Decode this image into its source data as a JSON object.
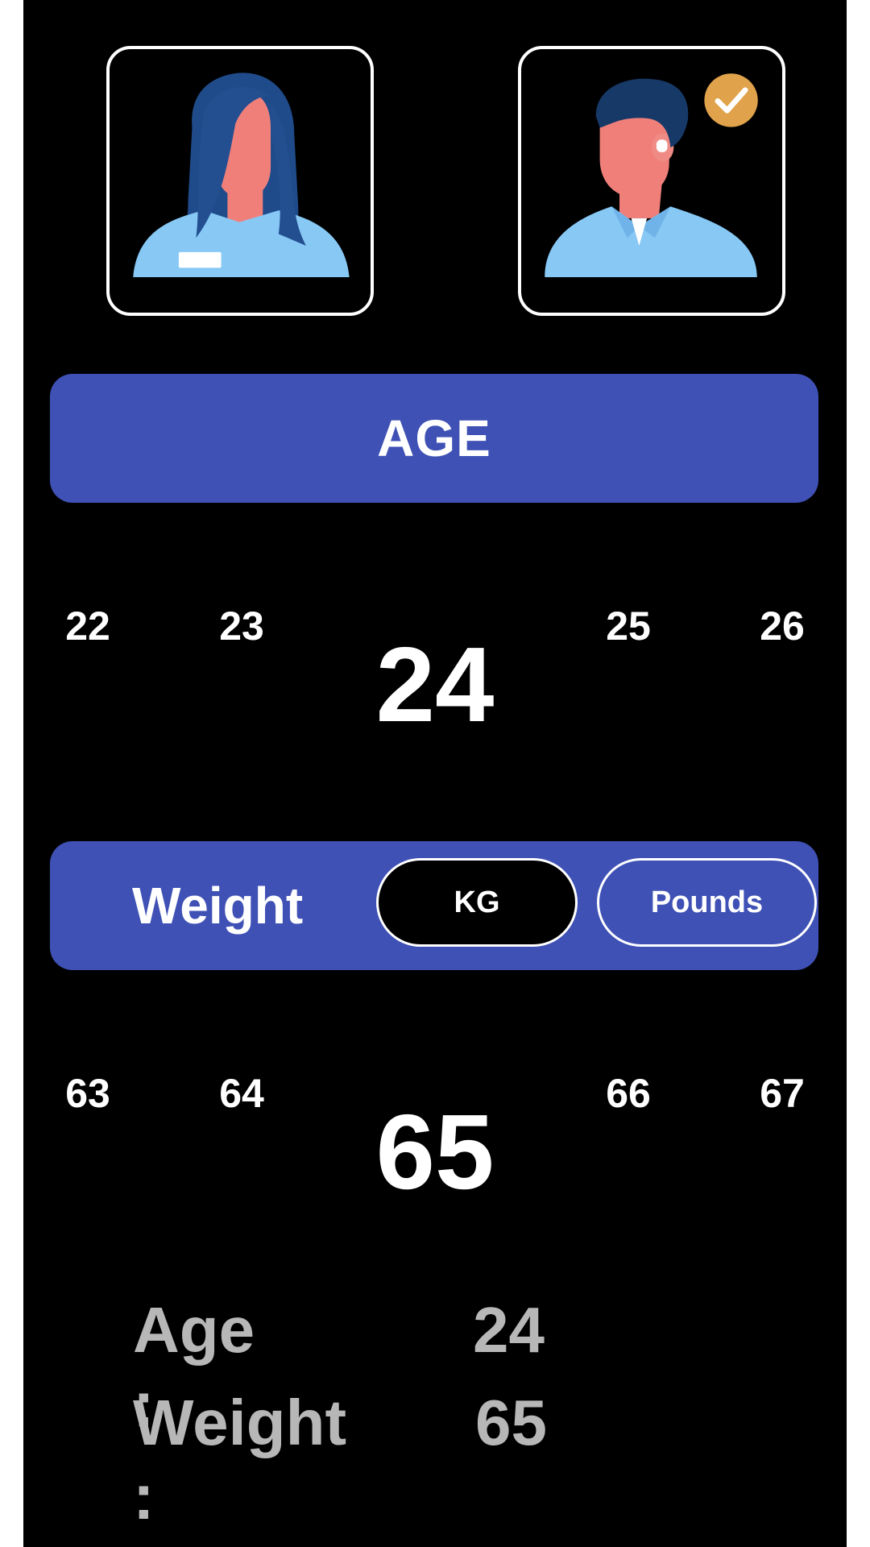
{
  "gender": {
    "female_label": "",
    "male_selected": true
  },
  "age": {
    "title": "AGE",
    "options": [
      "22",
      "23",
      "24",
      "25",
      "26"
    ],
    "selected": "24"
  },
  "weight": {
    "title": "Weight",
    "unit_kg": "KG",
    "unit_pounds": "Pounds",
    "active_unit": "KG",
    "options": [
      "63",
      "64",
      "65",
      "66",
      "67"
    ],
    "selected": "65"
  },
  "summary": {
    "age_label": "Age :",
    "age_value": "24",
    "weight_label": "Weight :",
    "weight_value": "65"
  },
  "colors": {
    "accent": "#3f51b5",
    "background": "#000000",
    "summary_text": "#b7b7b7",
    "check_badge": "#e0a24a"
  },
  "icons": {
    "female": "female-avatar-icon",
    "male": "male-avatar-icon",
    "selected": "checkmark-badge-icon"
  }
}
